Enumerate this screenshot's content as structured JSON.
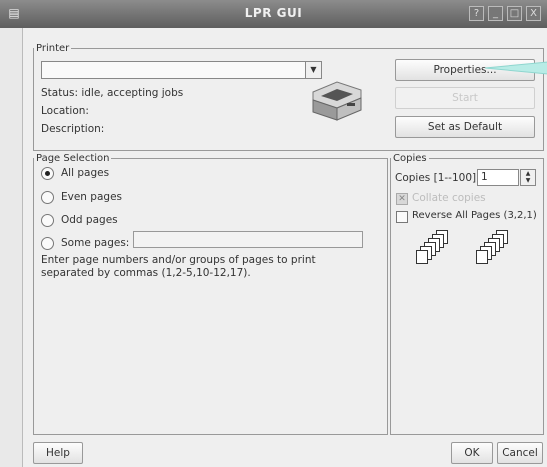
{
  "window": {
    "title": "LPR GUI",
    "controls": [
      "?",
      "_",
      "□",
      "X"
    ]
  },
  "printer": {
    "legend": "Printer",
    "selected": "",
    "status": "Status: idle, accepting jobs",
    "location": "Location:",
    "description": "Description:",
    "properties_label": "Properties...",
    "start_label": "Start",
    "default_label": "Set as Default"
  },
  "page_selection": {
    "legend": "Page Selection",
    "options": [
      "All pages",
      "Even pages",
      "Odd pages",
      "Some pages:"
    ],
    "selected": "All pages",
    "some_pages_value": "",
    "hint": "Enter page numbers and/or groups of pages to print separated by commas (1,2-5,10-12,17)."
  },
  "copies": {
    "legend": "Copies",
    "count_label": "Copies [1--100]:",
    "count_value": "1",
    "collate_label": "Collate copies",
    "collate_checked": true,
    "collate_enabled": false,
    "reverse_label": "Reverse All Pages (3,2,1)",
    "reverse_checked": false
  },
  "footer": {
    "help": "Help",
    "ok": "OK",
    "cancel": "Cancel"
  }
}
